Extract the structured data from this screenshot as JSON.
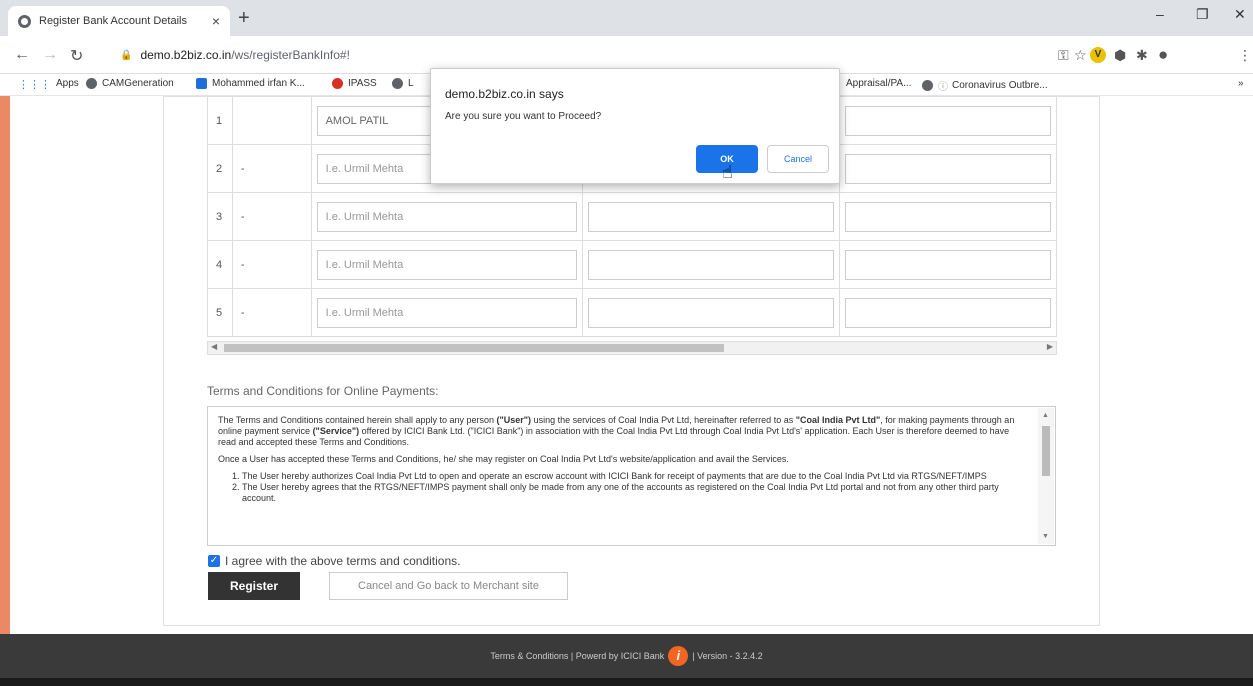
{
  "browser": {
    "tab_title": "Register Bank Account Details",
    "tab_close": "×",
    "new_tab": "+",
    "url_host": "demo.b2biz.co.in",
    "url_path": "/ws/registerBankInfo#!",
    "minimize": "–",
    "restore": "❐",
    "close": "✕",
    "bookmarks": [
      {
        "label": "Apps",
        "icon": "apps-grid-icon"
      },
      {
        "label": "CAMGeneration",
        "icon": "globe-icon"
      },
      {
        "label": "Mohammed irfan K...",
        "icon": "outlook-icon"
      },
      {
        "label": "IPASS",
        "icon": "ipass-icon"
      },
      {
        "label": "L",
        "icon": "globe-icon"
      },
      {
        "label": "Appraisal/PA...",
        "icon": "globe-icon"
      },
      {
        "label": "Coronavirus Outbre...",
        "icon": "info-icon"
      }
    ],
    "more_bookmarks": "»"
  },
  "table": {
    "rows": [
      {
        "num": "1",
        "dash": "",
        "placeholder": "AMOL PATIL"
      },
      {
        "num": "2",
        "dash": "-",
        "placeholder": "I.e. Urmil Mehta"
      },
      {
        "num": "3",
        "dash": "-",
        "placeholder": "I.e. Urmil Mehta"
      },
      {
        "num": "4",
        "dash": "-",
        "placeholder": "I.e. Urmil Mehta"
      },
      {
        "num": "5",
        "dash": "-",
        "placeholder": "I.e. Urmil Mehta"
      }
    ]
  },
  "terms": {
    "title": "Terms and Conditions for Online Payments:",
    "para1_a": "The Terms and Conditions contained herein shall apply to any person ",
    "para1_user": "(\"User\")",
    "para1_b": " using the services of Coal India Pvt Ltd, hereinafter referred to as ",
    "para1_cil": "\"Coal India Pvt Ltd\"",
    "para1_c": ", for making payments through an online payment service ",
    "para1_service": "(\"Service\")",
    "para1_d": " offered by ICICI Bank Ltd. (\"ICICI Bank\") in association with the Coal India Pvt Ltd through Coal India Pvt Ltd's' application. Each User is therefore deemed to have read and accepted these Terms and Conditions.",
    "para2": "Once a User has accepted these Terms and Conditions, he/ she may register on Coal India Pvt Ltd's website/application and avail the Services.",
    "items": [
      "The User hereby authorizes Coal India Pvt Ltd to open and operate an escrow account with ICICI Bank for receipt of payments that are due to the Coal India Pvt Ltd via RTGS/NEFT/IMPS",
      "The User hereby agrees that the RTGS/NEFT/IMPS payment shall only be made from any one of the accounts as registered on the Coal India Pvt Ltd portal and not from any other third party account."
    ]
  },
  "agree_label": "I agree with the above terms and conditions.",
  "buttons": {
    "register": "Register",
    "cancel": "Cancel and Go back to Merchant site"
  },
  "footer": {
    "text": "Terms & Conditions | Powerd by ICICI Bank",
    "version": "| Version - 3.2.4.2"
  },
  "dialog": {
    "title": "demo.b2biz.co.in says",
    "message": "Are you sure you want to Proceed?",
    "ok": "OK",
    "cancel": "Cancel"
  }
}
